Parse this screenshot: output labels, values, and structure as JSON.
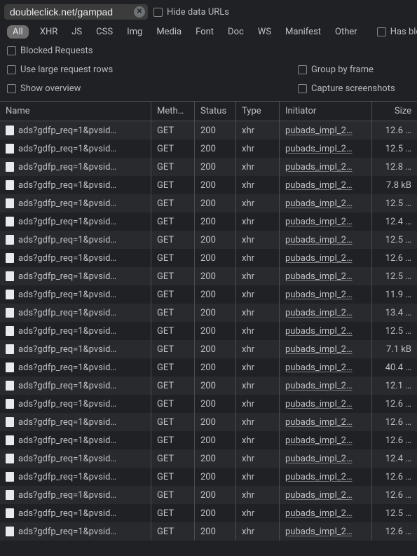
{
  "filter": {
    "value": "doubleclick.net/gampad",
    "hideDataUrls": "Hide data URLs",
    "hasBlocked": "Has blocke"
  },
  "filterTypes": [
    "All",
    "XHR",
    "JS",
    "CSS",
    "Img",
    "Media",
    "Font",
    "Doc",
    "WS",
    "Manifest",
    "Other"
  ],
  "blockedRequests": "Blocked Requests",
  "options": {
    "largeRows": "Use large request rows",
    "groupByFrame": "Group by frame",
    "showOverview": "Show overview",
    "captureScreenshots": "Capture screenshots"
  },
  "columns": {
    "name": "Name",
    "method": "Meth…",
    "status": "Status",
    "type": "Type",
    "initiator": "Initiator",
    "size": "Size"
  },
  "rows": [
    {
      "name": "ads?gdfp_req=1&pvsid…",
      "method": "GET",
      "status": "200",
      "type": "xhr",
      "initiator": "pubads_impl_2…",
      "size": "12.6 …"
    },
    {
      "name": "ads?gdfp_req=1&pvsid…",
      "method": "GET",
      "status": "200",
      "type": "xhr",
      "initiator": "pubads_impl_2…",
      "size": "12.5 …"
    },
    {
      "name": "ads?gdfp_req=1&pvsid…",
      "method": "GET",
      "status": "200",
      "type": "xhr",
      "initiator": "pubads_impl_2…",
      "size": "12.8 …"
    },
    {
      "name": "ads?gdfp_req=1&pvsid…",
      "method": "GET",
      "status": "200",
      "type": "xhr",
      "initiator": "pubads_impl_2…",
      "size": "7.8 kB"
    },
    {
      "name": "ads?gdfp_req=1&pvsid…",
      "method": "GET",
      "status": "200",
      "type": "xhr",
      "initiator": "pubads_impl_2…",
      "size": "12.5 …"
    },
    {
      "name": "ads?gdfp_req=1&pvsid…",
      "method": "GET",
      "status": "200",
      "type": "xhr",
      "initiator": "pubads_impl_2…",
      "size": "12.4 …"
    },
    {
      "name": "ads?gdfp_req=1&pvsid…",
      "method": "GET",
      "status": "200",
      "type": "xhr",
      "initiator": "pubads_impl_2…",
      "size": "12.5 …"
    },
    {
      "name": "ads?gdfp_req=1&pvsid…",
      "method": "GET",
      "status": "200",
      "type": "xhr",
      "initiator": "pubads_impl_2…",
      "size": "12.6 …"
    },
    {
      "name": "ads?gdfp_req=1&pvsid…",
      "method": "GET",
      "status": "200",
      "type": "xhr",
      "initiator": "pubads_impl_2…",
      "size": "12.5 …"
    },
    {
      "name": "ads?gdfp_req=1&pvsid…",
      "method": "GET",
      "status": "200",
      "type": "xhr",
      "initiator": "pubads_impl_2…",
      "size": "11.9 …"
    },
    {
      "name": "ads?gdfp_req=1&pvsid…",
      "method": "GET",
      "status": "200",
      "type": "xhr",
      "initiator": "pubads_impl_2…",
      "size": "13.4 …"
    },
    {
      "name": "ads?gdfp_req=1&pvsid…",
      "method": "GET",
      "status": "200",
      "type": "xhr",
      "initiator": "pubads_impl_2…",
      "size": "12.5 …"
    },
    {
      "name": "ads?gdfp_req=1&pvsid…",
      "method": "GET",
      "status": "200",
      "type": "xhr",
      "initiator": "pubads_impl_2…",
      "size": "7.1 kB"
    },
    {
      "name": "ads?gdfp_req=1&pvsid…",
      "method": "GET",
      "status": "200",
      "type": "xhr",
      "initiator": "pubads_impl_2…",
      "size": "40.4 …"
    },
    {
      "name": "ads?gdfp_req=1&pvsid…",
      "method": "GET",
      "status": "200",
      "type": "xhr",
      "initiator": "pubads_impl_2…",
      "size": "12.1 …"
    },
    {
      "name": "ads?gdfp_req=1&pvsid…",
      "method": "GET",
      "status": "200",
      "type": "xhr",
      "initiator": "pubads_impl_2…",
      "size": "12.6 …"
    },
    {
      "name": "ads?gdfp_req=1&pvsid…",
      "method": "GET",
      "status": "200",
      "type": "xhr",
      "initiator": "pubads_impl_2…",
      "size": "12.6 …"
    },
    {
      "name": "ads?gdfp_req=1&pvsid…",
      "method": "GET",
      "status": "200",
      "type": "xhr",
      "initiator": "pubads_impl_2…",
      "size": "12.6 …"
    },
    {
      "name": "ads?gdfp_req=1&pvsid…",
      "method": "GET",
      "status": "200",
      "type": "xhr",
      "initiator": "pubads_impl_2…",
      "size": "12.4 …"
    },
    {
      "name": "ads?gdfp_req=1&pvsid…",
      "method": "GET",
      "status": "200",
      "type": "xhr",
      "initiator": "pubads_impl_2…",
      "size": "12.6 …"
    },
    {
      "name": "ads?gdfp_req=1&pvsid…",
      "method": "GET",
      "status": "200",
      "type": "xhr",
      "initiator": "pubads_impl_2…",
      "size": "12.6 …"
    },
    {
      "name": "ads?gdfp_req=1&pvsid…",
      "method": "GET",
      "status": "200",
      "type": "xhr",
      "initiator": "pubads_impl_2…",
      "size": "12.5 …"
    },
    {
      "name": "ads?gdfp_req=1&pvsid…",
      "method": "GET",
      "status": "200",
      "type": "xhr",
      "initiator": "pubads_impl_2…",
      "size": "12.6 …"
    }
  ]
}
